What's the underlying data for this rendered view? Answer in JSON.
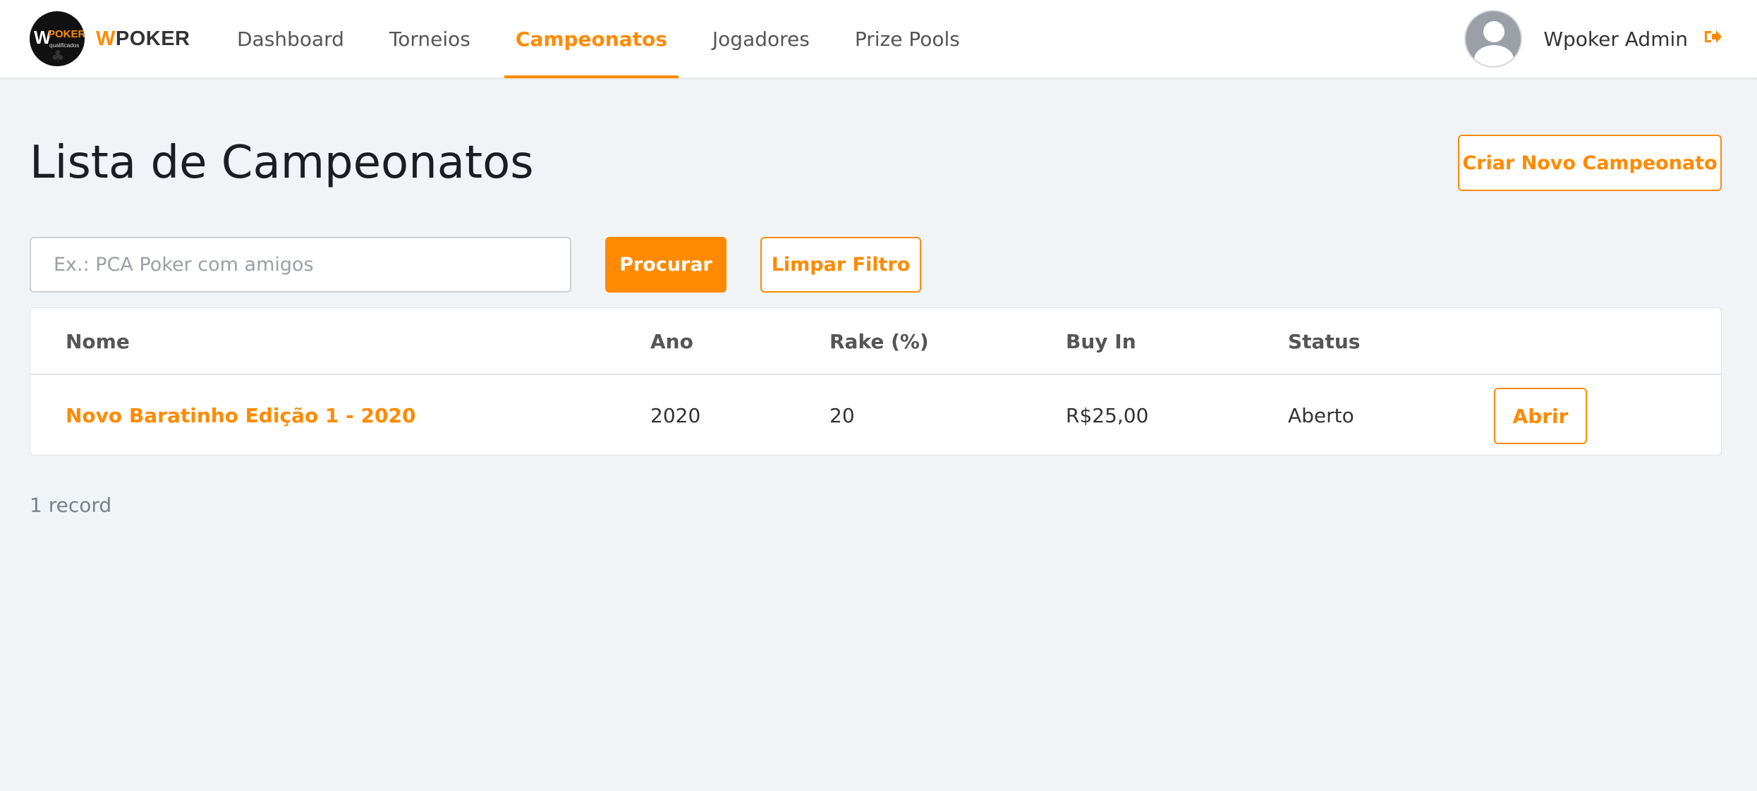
{
  "header": {
    "logo": {
      "w": "W",
      "poker": "POKER",
      "sub": "qualificados"
    },
    "brand_w": "W",
    "brand_rest": "POKER",
    "nav": [
      {
        "label": "Dashboard"
      },
      {
        "label": "Torneios"
      },
      {
        "label": "Campeonatos",
        "active": true
      },
      {
        "label": "Jogadores"
      },
      {
        "label": "Prize Pools"
      }
    ],
    "user_name": "Wpoker Admin"
  },
  "main": {
    "title": "Lista de Campeonatos",
    "create_button": "Criar Novo Campeonato",
    "search": {
      "placeholder": "Ex.: PCA Poker com amigos",
      "value": ""
    },
    "search_button": "Procurar",
    "clear_button": "Limpar Filtro",
    "table": {
      "columns": [
        "Nome",
        "Ano",
        "Rake (%)",
        "Buy In",
        "Status"
      ],
      "rows": [
        {
          "nome": "Novo Baratinho Edição 1 - 2020",
          "ano": "2020",
          "rake": "20",
          "buy_in": "R$25,00",
          "status": "Aberto",
          "action": "Abrir"
        }
      ]
    },
    "record_count": "1 record"
  },
  "colors": {
    "accent": "#ff8a00",
    "background": "#f1f4f7"
  },
  "icons": {
    "logout": "logout-icon",
    "avatar": "user-avatar-icon"
  }
}
